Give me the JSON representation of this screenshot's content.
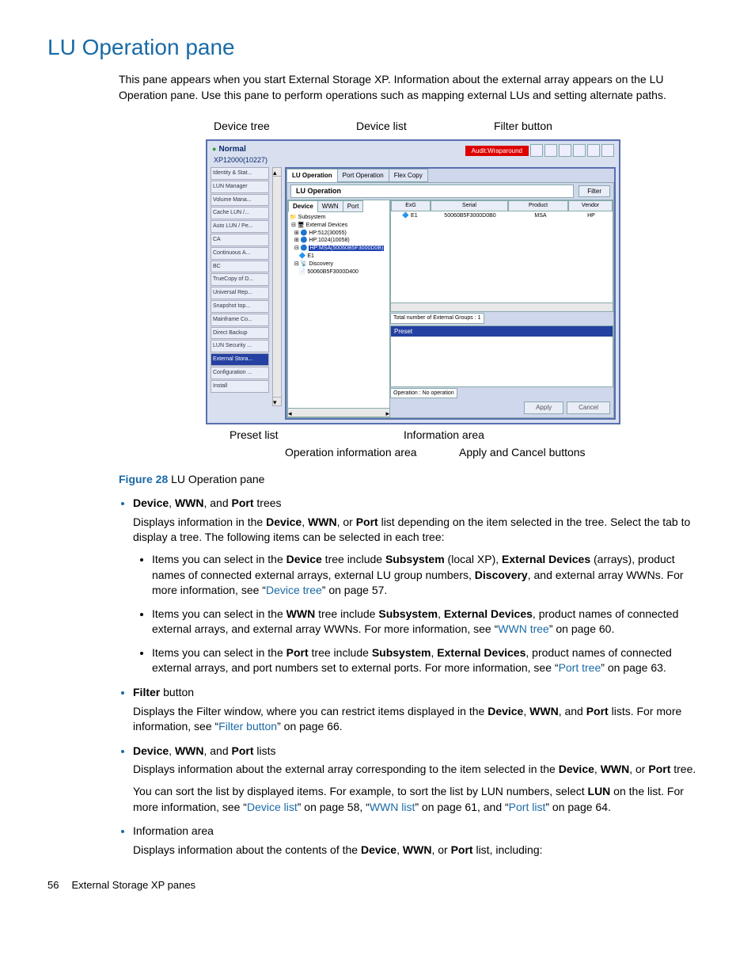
{
  "page": {
    "title": "LU Operation pane",
    "intro": "This pane appears when you start External Storage XP. Information about the external array appears on the LU Operation pane. Use this pane to perform operations such as mapping external LUs and setting alternate paths.",
    "figure_number": "Figure 28",
    "figure_caption": "LU Operation pane",
    "page_number": "56",
    "footer_section": "External Storage XP panes"
  },
  "callouts": {
    "top": {
      "device_tree": "Device tree",
      "device_list": "Device list",
      "filter_button": "Filter button"
    },
    "bottom": {
      "preset_list": "Preset list",
      "operation_info": "Operation information area",
      "info_area": "Information area",
      "apply_cancel": "Apply and Cancel buttons"
    }
  },
  "app": {
    "status": "Normal",
    "model": "XP12000(10227)",
    "badge": "Audit:Wraparound",
    "sidebar": [
      "Identity & Stat...",
      "LUN Manager",
      "Volume Mana...",
      "Cache LUN /...",
      "Auto LUN / Pe...",
      "CA",
      "Continuous A...",
      "BC",
      "TrueCopy of D...",
      "Universal Rep...",
      "Snapshot top...",
      "Mainframe Co...",
      "Direct Backup",
      "LUN Security ...",
      "External Stora...",
      "Configuration ...",
      "Install"
    ],
    "sidebar_selected_index": 14,
    "outer_tabs": [
      "LU Operation",
      "Port Operation",
      "Flex Copy"
    ],
    "outer_tab_active": 0,
    "panel_title": "LU Operation",
    "filter_label": "Filter",
    "tree_tabs": [
      "Device",
      "WWN",
      "Port"
    ],
    "tree_tab_active": 0,
    "tree": {
      "root": "Subsystem",
      "l1": "External Devices",
      "l2a": "HP:512(30055)",
      "l2b": "HP:1024(10058)",
      "l2c": "HP:MSA(50060B5F3000D0B)",
      "l3a": "E1",
      "l2d": "Discovery",
      "l3b": "50060B5F3000D400"
    },
    "list": {
      "headers": [
        "ExG",
        "Serial",
        "Product",
        "Vendor"
      ],
      "row": [
        "E1",
        "50060B5F3000D0B0",
        "MSA",
        "HP"
      ]
    },
    "info_total": "Total number of External Groups : 1",
    "preset_label": "Preset",
    "operation_info": "Operation : No operation",
    "apply": "Apply",
    "cancel": "Cancel"
  },
  "bullets": {
    "b1_head": "Device, WWN, and Port trees",
    "b1_p": "Displays information in the Device, WWN, or Port list depending on the item selected in the tree. Select the tab to display a tree. The following items can be selected in each tree:",
    "b1_s1a": "Items you can select in the ",
    "b1_s1b": " tree include ",
    "b1_s1c": " (local XP), ",
    "b1_s1d": " (arrays), product names of connected external arrays, external LU group numbers, ",
    "b1_s1e": ", and external array WWNs. For more information, see “",
    "b1_s1f": "” on page 57.",
    "b1_s2a": "Items you can select in the ",
    "b1_s2b": " tree include ",
    "b1_s2c": ", product names of connected external arrays, and external array WWNs. For more information, see “",
    "b1_s2d": "” on page 60.",
    "b1_s3a": "Items you can select in the ",
    "b1_s3b": " tree include ",
    "b1_s3c": ", product names of connected external arrays, and port numbers set to external ports. For more information, see “",
    "b1_s3d": "” on page 63.",
    "b2_head": "Filter button",
    "b2_p_a": "Displays the Filter window, where you can restrict items displayed in the ",
    "b2_p_b": " lists. For more information, see “",
    "b2_p_c": "” on page 66.",
    "b3_head": "Device, WWN, and Port lists",
    "b3_p1": "Displays information about the external array corresponding to the item selected in the Device, WWN, or Port tree.",
    "b3_p2a": "You can sort the list by displayed items. For example, to sort the list by LUN numbers, select ",
    "b3_p2b": " on the list. For more information, see “",
    "b3_p2c": "” on page 58, “",
    "b3_p2d": "” on page 61, and “",
    "b3_p2e": "” on page 64.",
    "b4_head": "Information area",
    "b4_p": "Displays information about the contents of the Device, WWN, or Port list, including:"
  },
  "terms": {
    "device": "Device",
    "wwn": "WWN",
    "port": "Port",
    "subsystem": "Subsystem",
    "ext_devices": "External Devices",
    "discovery": "Discovery",
    "lun": "LUN",
    "device_tree": "Device tree",
    "wwn_tree": "WWN tree",
    "port_tree": "Port tree",
    "filter_button": "Filter button",
    "device_list": "Device list",
    "wwn_list": "WWN list",
    "port_list": "Port list"
  }
}
